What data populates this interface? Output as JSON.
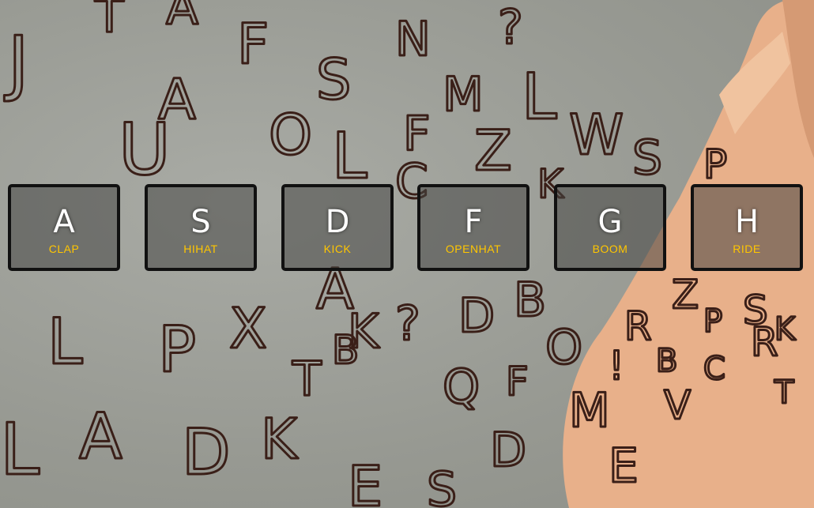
{
  "keys": [
    {
      "key": "A",
      "sound": "clap"
    },
    {
      "key": "S",
      "sound": "hihat"
    },
    {
      "key": "D",
      "sound": "kick"
    },
    {
      "key": "F",
      "sound": "openhat"
    },
    {
      "key": "G",
      "sound": "boom"
    },
    {
      "key": "H",
      "sound": "ride"
    }
  ],
  "colors": {
    "sound_label": "#ffc600",
    "key_border": "#111111",
    "key_text": "#ffffff"
  }
}
